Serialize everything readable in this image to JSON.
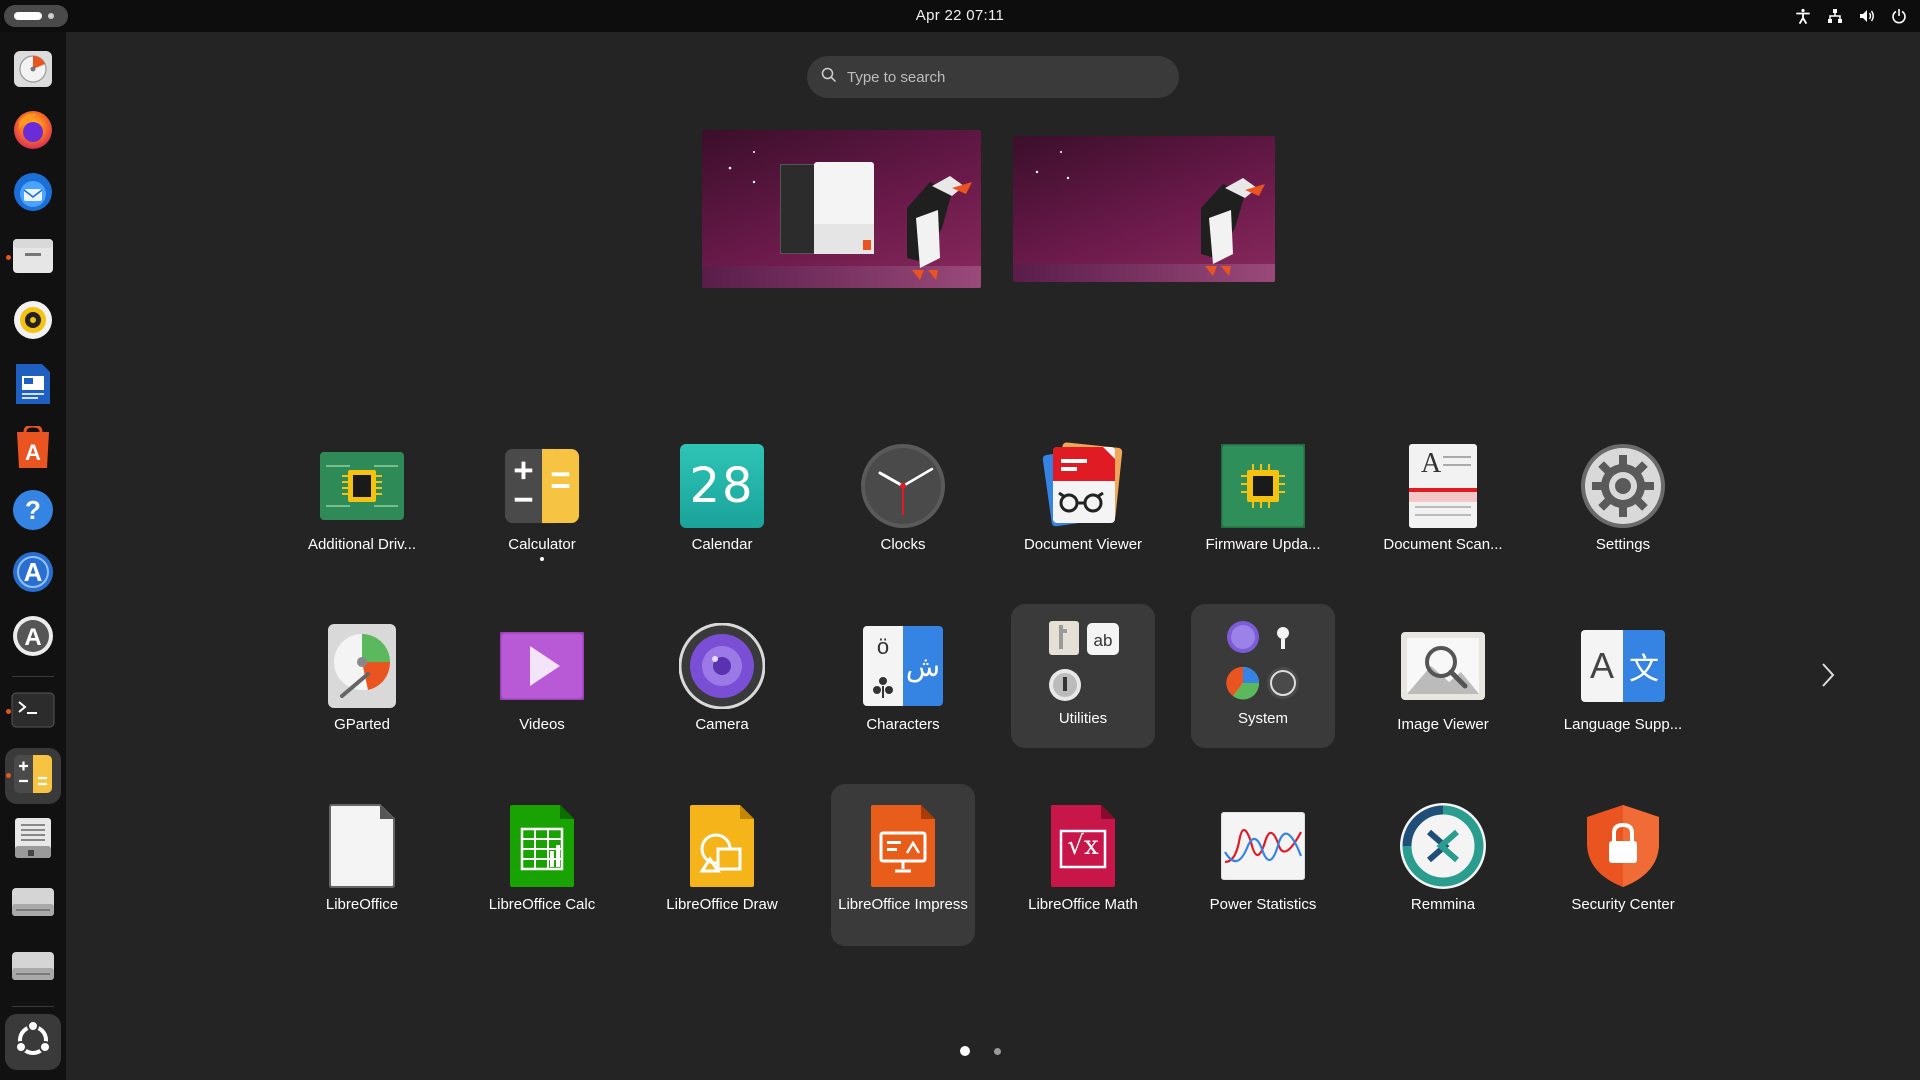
{
  "topbar": {
    "clock": "Apr 22  07:11",
    "tray_icons": [
      "accessibility-icon",
      "network-icon",
      "volume-icon",
      "power-icon"
    ]
  },
  "search": {
    "placeholder": "Type to search"
  },
  "dock": {
    "items": [
      {
        "name": "disk-usage-icon"
      },
      {
        "name": "firefox-icon"
      },
      {
        "name": "thunderbird-icon"
      },
      {
        "name": "files-icon"
      },
      {
        "name": "rhythmbox-icon"
      },
      {
        "name": "writer-icon"
      },
      {
        "name": "app-center-icon"
      },
      {
        "name": "help-icon"
      },
      {
        "name": "software-updater-icon"
      },
      {
        "name": "app-store-icon"
      },
      {
        "name": "terminal-icon"
      },
      {
        "name": "calculator-icon"
      },
      {
        "name": "text-editor-icon"
      },
      {
        "name": "drive-icon-1"
      },
      {
        "name": "drive-icon-2"
      },
      {
        "name": "show-apps-icon"
      }
    ]
  },
  "apps": {
    "row1": [
      {
        "label": "Additional Driv...",
        "icon": "chip-icon"
      },
      {
        "label": "Calculator",
        "icon": "calculator-icon",
        "running": true
      },
      {
        "label": "Calendar",
        "icon": "calendar-icon",
        "day": "28"
      },
      {
        "label": "Clocks",
        "icon": "clock-icon"
      },
      {
        "label": "Document Viewer",
        "icon": "document-viewer-icon"
      },
      {
        "label": "Firmware Upda...",
        "icon": "firmware-icon"
      },
      {
        "label": "Document Scan...",
        "icon": "scanner-icon"
      },
      {
        "label": "Settings",
        "icon": "gear-icon"
      }
    ],
    "row2": [
      {
        "label": "GParted",
        "icon": "gparted-icon"
      },
      {
        "label": "Videos",
        "icon": "videos-icon"
      },
      {
        "label": "Camera",
        "icon": "camera-icon"
      },
      {
        "label": "Characters",
        "icon": "characters-icon",
        "glyph": "ش",
        "glyph2": "ö"
      },
      {
        "label": "Utilities",
        "icon": "folder-icon",
        "glyph": "a b"
      },
      {
        "label": "System",
        "icon": "folder-icon"
      },
      {
        "label": "Image Viewer",
        "icon": "image-viewer-icon"
      },
      {
        "label": "Language Supp...",
        "icon": "language-icon",
        "glyph": "A",
        "glyph2": "文"
      }
    ],
    "row3": [
      {
        "label": "LibreOffice",
        "icon": "libreoffice-icon"
      },
      {
        "label": "LibreOffice Calc",
        "icon": "calc-icon"
      },
      {
        "label": "LibreOffice Draw",
        "icon": "draw-icon"
      },
      {
        "label": "LibreOffice Impress",
        "icon": "impress-icon"
      },
      {
        "label": "LibreOffice Math",
        "icon": "math-icon",
        "glyph": "√x"
      },
      {
        "label": "Power Statistics",
        "icon": "power-stats-icon"
      },
      {
        "label": "Remmina",
        "icon": "remmina-icon"
      },
      {
        "label": "Security Center",
        "icon": "security-icon"
      }
    ]
  },
  "pager": {
    "pages": 2,
    "current": 1
  }
}
